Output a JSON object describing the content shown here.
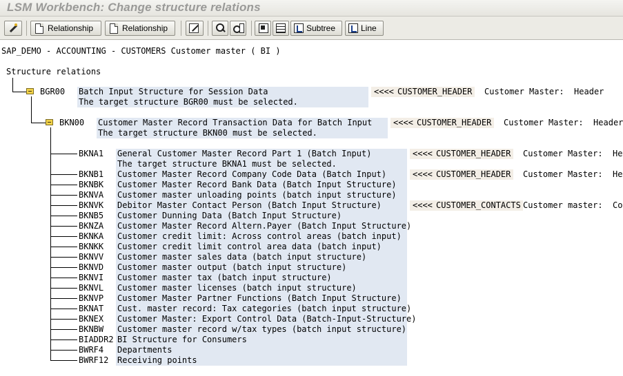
{
  "window": {
    "title": "LSM Workbench: Change structure relations"
  },
  "toolbar": {
    "relationship_1": "Relationship",
    "relationship_2": "Relationship",
    "subtree": "Subtree",
    "line": "Line"
  },
  "header": {
    "object_line": "SAP_DEMO - ACCOUNTING - CUSTOMERS Customer master ( BI )",
    "section_title": "Structure relations"
  },
  "tree": {
    "bgr00": {
      "name": "BGR00",
      "desc": "Batch Input Structure for Session Data",
      "message": "The target structure BGR00 must be selected.",
      "arrow": "<<<<",
      "source": "CUSTOMER_HEADER",
      "source_desc": "Customer Master:  Header"
    },
    "bkn00": {
      "name": "BKN00",
      "desc": "Customer Master Record Transaction Data for Batch Input",
      "message": "The target structure BKN00 must be selected.",
      "arrow": "<<<<",
      "source": "CUSTOMER_HEADER",
      "source_desc": "Customer Master:  Header"
    },
    "children": [
      {
        "name": "BKNA1",
        "desc": "General Customer Master Record Part 1 (Batch Input)",
        "message": "The target structure BKNA1 must be selected.",
        "arrow": "<<<<",
        "source": "CUSTOMER_HEADER",
        "source_desc": "Customer Master:  Hea"
      },
      {
        "name": "BKNB1",
        "desc": "Customer Master Record Company Code Data (Batch Input)",
        "arrow": "<<<<",
        "source": "CUSTOMER_HEADER",
        "source_desc": "Customer Master:  Hea"
      },
      {
        "name": "BKNBK",
        "desc": "Customer Master Record Bank Data (Batch Input Structure)"
      },
      {
        "name": "BKNVA",
        "desc": "Customer master unloading points (batch input structure)"
      },
      {
        "name": "BKNVK",
        "desc": "Debitor Master Contact Person (Batch Input Structure)",
        "arrow": "<<<<",
        "source": "CUSTOMER_CONTACTS",
        "source_desc": "Customer master:  Con"
      },
      {
        "name": "BKNB5",
        "desc": "Customer Dunning Data (Batch Input Structure)"
      },
      {
        "name": "BKNZA",
        "desc": "Customer Master Record Altern.Payer (Batch Input Structure)"
      },
      {
        "name": "BKNKA",
        "desc": "Customer credit limit: Across control areas (batch input)"
      },
      {
        "name": "BKNKK",
        "desc": "Customer credit limit control area data (batch input)"
      },
      {
        "name": "BKNVV",
        "desc": "Customer master sales data (batch input structure)"
      },
      {
        "name": "BKNVD",
        "desc": "Customer master output (batch input structure)"
      },
      {
        "name": "BKNVI",
        "desc": "Customer master tax (batch input structure)"
      },
      {
        "name": "BKNVL",
        "desc": "Customer master licenses (batch input structure)"
      },
      {
        "name": "BKNVP",
        "desc": "Customer Master Partner Functions (Batch Input Structure)"
      },
      {
        "name": "BKNAT",
        "desc": "Cust. master record: Tax categories (batch input structure)"
      },
      {
        "name": "BKNEX",
        "desc": "Customer Master: Export Control Data (Batch-Input-Structure)"
      },
      {
        "name": "BKNBW",
        "desc": "Customer master record w/tax types (batch input structure)"
      },
      {
        "name": "BIADDR2",
        "desc": "BI Structure for Consumers"
      },
      {
        "name": "BWRF4",
        "desc": "Departments"
      },
      {
        "name": "BWRF12",
        "desc": "Receiving points"
      }
    ]
  }
}
